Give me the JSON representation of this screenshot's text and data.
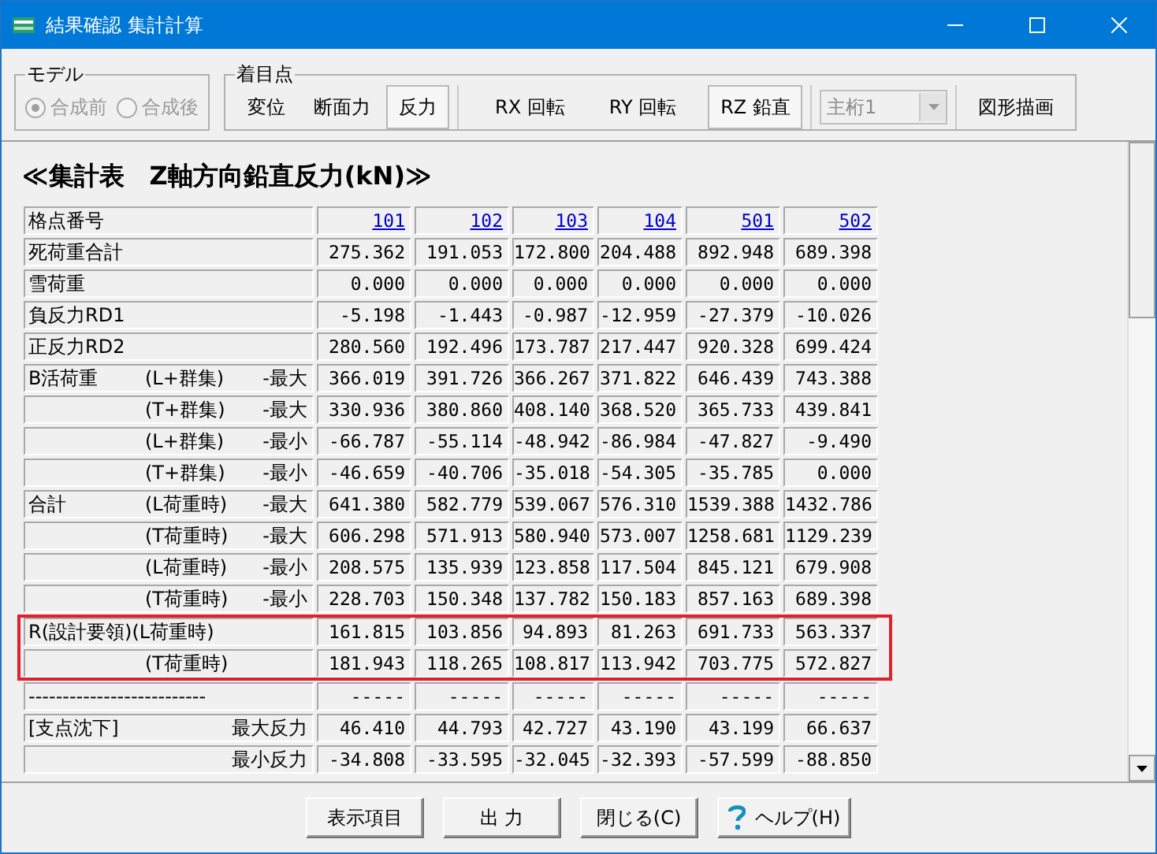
{
  "window": {
    "title": "結果確認 集計計算"
  },
  "model_group": {
    "title": "モデル",
    "disabled": true,
    "options": [
      {
        "label": "合成前",
        "selected": true
      },
      {
        "label": "合成後",
        "selected": false
      }
    ]
  },
  "focus_group": {
    "title": "着目点",
    "buttons": [
      {
        "label": "変位",
        "selected": false
      },
      {
        "label": "断面力",
        "selected": false
      },
      {
        "label": "反力",
        "selected": true
      }
    ],
    "buttons2": [
      {
        "label": "RX 回転",
        "selected": false
      },
      {
        "label": "RY 回転",
        "selected": false
      },
      {
        "label": "RZ 鉛直",
        "selected": true
      }
    ],
    "dropdown": {
      "value": "主桁1",
      "disabled": true
    },
    "draw_button": "図形描画"
  },
  "heading": "≪集計表　Z軸方向鉛直反力(kN)≫",
  "table": {
    "header_label": "格点番号",
    "columns": [
      "101",
      "102",
      "103",
      "104",
      "501",
      "502"
    ],
    "rows": [
      {
        "group": "死荷重合計",
        "values": [
          "275.362",
          "191.053",
          "172.800",
          "204.488",
          "892.948",
          "689.398"
        ],
        "highlighted": false
      },
      {
        "group": "雪荷重",
        "values": [
          "0.000",
          "0.000",
          "0.000",
          "0.000",
          "0.000",
          "0.000"
        ],
        "highlighted": false
      },
      {
        "group": "負反力RD1",
        "values": [
          "-5.198",
          "-1.443",
          "-0.987",
          "-12.959",
          "-27.379",
          "-10.026"
        ],
        "highlighted": false
      },
      {
        "group": "正反力RD2",
        "values": [
          "280.560",
          "192.496",
          "173.787",
          "217.447",
          "920.328",
          "699.424"
        ],
        "highlighted": false
      },
      {
        "group": "B活荷重",
        "case": "(L+群集)",
        "extreme": "-最大",
        "values": [
          "366.019",
          "391.726",
          "366.267",
          "371.822",
          "646.439",
          "743.388"
        ],
        "highlighted": false
      },
      {
        "case": "(T+群集)",
        "extreme": "-最大",
        "values": [
          "330.936",
          "380.860",
          "408.140",
          "368.520",
          "365.733",
          "439.841"
        ],
        "highlighted": false
      },
      {
        "case": "(L+群集)",
        "extreme": "-最小",
        "values": [
          "-66.787",
          "-55.114",
          "-48.942",
          "-86.984",
          "-47.827",
          "-9.490"
        ],
        "highlighted": false
      },
      {
        "case": "(T+群集)",
        "extreme": "-最小",
        "values": [
          "-46.659",
          "-40.706",
          "-35.018",
          "-54.305",
          "-35.785",
          "0.000"
        ],
        "highlighted": false
      },
      {
        "group": "合計",
        "case": "(L荷重時)",
        "extreme": "-最大",
        "values": [
          "641.380",
          "582.779",
          "539.067",
          "576.310",
          "1539.388",
          "1432.786"
        ],
        "highlighted": false
      },
      {
        "case": "(T荷重時)",
        "extreme": "-最大",
        "values": [
          "606.298",
          "571.913",
          "580.940",
          "573.007",
          "1258.681",
          "1129.239"
        ],
        "highlighted": false
      },
      {
        "case": "(L荷重時)",
        "extreme": "-最小",
        "values": [
          "208.575",
          "135.939",
          "123.858",
          "117.504",
          "845.121",
          "679.908"
        ],
        "highlighted": false
      },
      {
        "case": "(T荷重時)",
        "extreme": "-最小",
        "values": [
          "228.703",
          "150.348",
          "137.782",
          "150.183",
          "857.163",
          "689.398"
        ],
        "highlighted": false
      },
      {
        "group": "R(設計要領)(L荷重時)",
        "values": [
          "161.815",
          "103.856",
          "94.893",
          "81.263",
          "691.733",
          "563.337"
        ],
        "highlighted": true
      },
      {
        "case": "(T荷重時)",
        "values": [
          "181.943",
          "118.265",
          "108.817",
          "113.942",
          "703.775",
          "572.827"
        ],
        "highlighted": true
      },
      {
        "group": "--------------------------",
        "values": [
          "-----",
          "-----",
          "-----",
          "-----",
          "-----",
          "-----"
        ],
        "highlighted": false
      },
      {
        "group": "[支点沈下]",
        "extreme": "最大反力",
        "values": [
          "46.410",
          "44.793",
          "42.727",
          "43.190",
          "43.199",
          "66.637"
        ],
        "highlighted": false
      },
      {
        "extreme": "最小反力",
        "values": [
          "-34.808",
          "-33.595",
          "-32.045",
          "-32.393",
          "-57.599",
          "-88.850"
        ],
        "highlighted": false
      }
    ]
  },
  "footer_buttons": [
    {
      "label": "表示項目",
      "kind": "plain"
    },
    {
      "label": "出 力",
      "kind": "plain"
    },
    {
      "label": "閉じる(C)",
      "kind": "plain"
    },
    {
      "label": "ヘルプ(H)",
      "kind": "help"
    }
  ]
}
